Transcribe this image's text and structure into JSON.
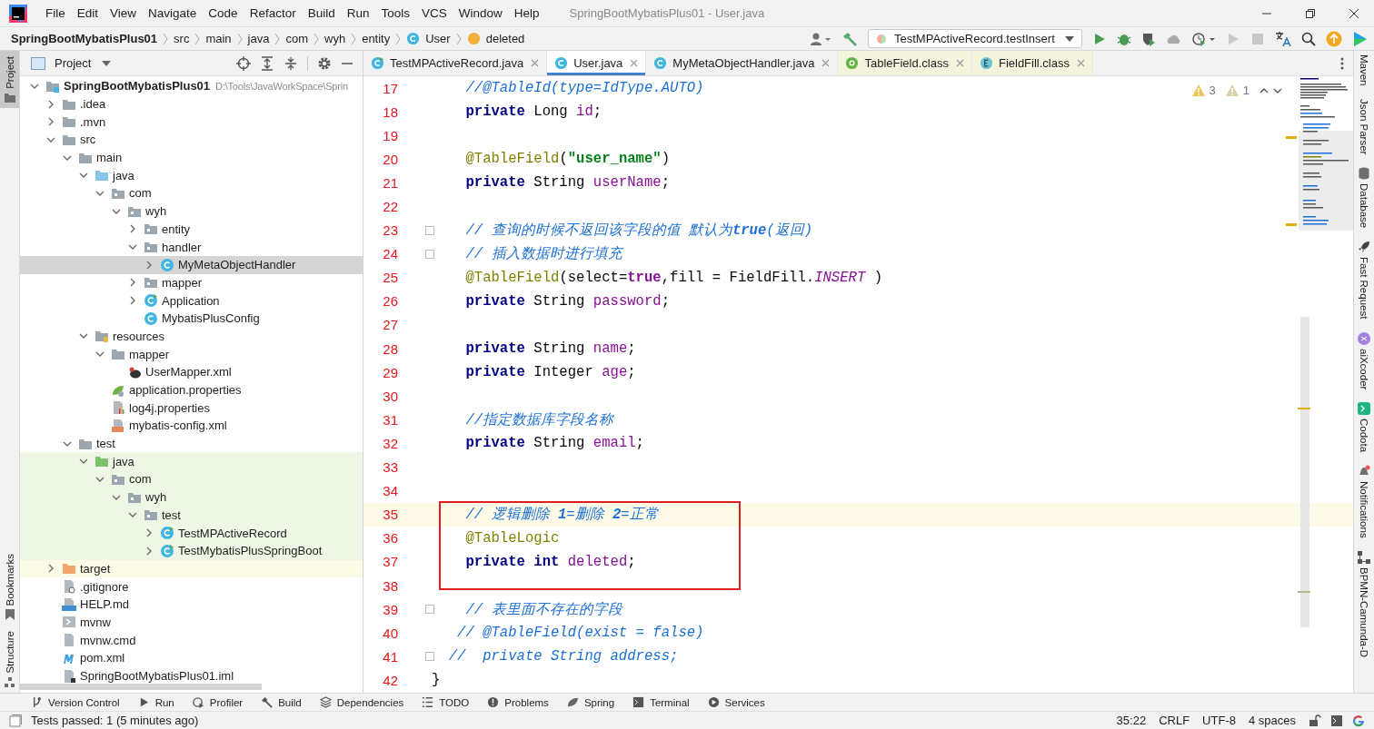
{
  "window": {
    "title": "SpringBootMybatisPlus01 - User.java"
  },
  "menu": [
    "File",
    "Edit",
    "View",
    "Navigate",
    "Code",
    "Refactor",
    "Build",
    "Run",
    "Tools",
    "VCS",
    "Window",
    "Help"
  ],
  "breadcrumbs": [
    {
      "label": "SpringBootMybatisPlus01",
      "kind": "project"
    },
    {
      "label": "src",
      "kind": "folder"
    },
    {
      "label": "main",
      "kind": "folder"
    },
    {
      "label": "java",
      "kind": "folder"
    },
    {
      "label": "com",
      "kind": "folder"
    },
    {
      "label": "wyh",
      "kind": "folder"
    },
    {
      "label": "entity",
      "kind": "folder"
    },
    {
      "label": "User",
      "kind": "class"
    },
    {
      "label": "deleted",
      "kind": "field"
    }
  ],
  "run_config": {
    "label": "TestMPActiveRecord.testInsert"
  },
  "project_panel": {
    "title": "Project"
  },
  "tree": [
    {
      "label": "SpringBootMybatisPlus01",
      "path": "D:\\Tools\\JavaWorkSpace\\Sprin",
      "kind": "module",
      "expanded": true,
      "selected": false,
      "children": [
        {
          "label": ".idea",
          "kind": "folder",
          "expanded": false,
          "selected": false
        },
        {
          "label": ".mvn",
          "kind": "folder",
          "expanded": false,
          "selected": false
        },
        {
          "label": "src",
          "kind": "folder",
          "expanded": true,
          "selected": false,
          "children": [
            {
              "label": "main",
              "kind": "folder",
              "expanded": true,
              "selected": false,
              "children": [
                {
                  "label": "java",
                  "kind": "folder-source",
                  "expanded": true,
                  "selected": false,
                  "children": [
                    {
                      "label": "com",
                      "kind": "package",
                      "expanded": true,
                      "selected": false,
                      "children": [
                        {
                          "label": "wyh",
                          "kind": "package",
                          "expanded": true,
                          "selected": false,
                          "children": [
                            {
                              "label": "entity",
                              "kind": "package",
                              "expanded": false,
                              "selected": false
                            },
                            {
                              "label": "handler",
                              "kind": "package",
                              "expanded": true,
                              "selected": false,
                              "children": [
                                {
                                  "label": "MyMetaObjectHandler",
                                  "kind": "class",
                                  "expanded": false,
                                  "selected": true
                                }
                              ]
                            },
                            {
                              "label": "mapper",
                              "kind": "package",
                              "expanded": false,
                              "selected": false
                            },
                            {
                              "label": "Application",
                              "kind": "class-run",
                              "expanded": false,
                              "selected": false
                            },
                            {
                              "label": "MybatisPlusConfig",
                              "kind": "class",
                              "selected": false
                            }
                          ]
                        }
                      ]
                    }
                  ]
                },
                {
                  "label": "resources",
                  "kind": "folder-resources",
                  "expanded": true,
                  "selected": false,
                  "children": [
                    {
                      "label": "mapper",
                      "kind": "folder",
                      "expanded": true,
                      "selected": false,
                      "children": [
                        {
                          "label": "UserMapper.xml",
                          "kind": "mybatis-xml",
                          "selected": false
                        }
                      ]
                    },
                    {
                      "label": "application.properties",
                      "kind": "spring-properties",
                      "selected": false
                    },
                    {
                      "label": "log4j.properties",
                      "kind": "properties",
                      "selected": false
                    },
                    {
                      "label": "mybatis-config.xml",
                      "kind": "xml",
                      "selected": false
                    }
                  ]
                }
              ]
            },
            {
              "label": "test",
              "kind": "folder",
              "expanded": true,
              "selected": false,
              "children": [
                {
                  "label": "java",
                  "kind": "folder-test",
                  "expanded": true,
                  "selected": false,
                  "test_scope": true,
                  "children": [
                    {
                      "label": "com",
                      "kind": "package",
                      "expanded": true,
                      "selected": false,
                      "test_scope": true,
                      "children": [
                        {
                          "label": "wyh",
                          "kind": "package",
                          "expanded": true,
                          "selected": false,
                          "test_scope": true,
                          "children": [
                            {
                              "label": "test",
                              "kind": "package",
                              "expanded": true,
                              "selected": false,
                              "test_scope": true,
                              "children": [
                                {
                                  "label": "TestMPActiveRecord",
                                  "kind": "class-test",
                                  "expanded": false,
                                  "selected": false,
                                  "test_scope": true
                                },
                                {
                                  "label": "TestMybatisPlusSpringBoot",
                                  "kind": "class-test",
                                  "expanded": false,
                                  "selected": false,
                                  "test_scope": true
                                }
                              ]
                            }
                          ]
                        }
                      ]
                    }
                  ]
                }
              ]
            }
          ]
        },
        {
          "label": "target",
          "kind": "folder-excluded",
          "expanded": false,
          "selected": false,
          "excluded": true
        },
        {
          "label": ".gitignore",
          "kind": "gitignore",
          "selected": false
        },
        {
          "label": "HELP.md",
          "kind": "markdown",
          "selected": false
        },
        {
          "label": "mvnw",
          "kind": "script",
          "selected": false
        },
        {
          "label": "mvnw.cmd",
          "kind": "text",
          "selected": false
        },
        {
          "label": "pom.xml",
          "kind": "maven",
          "selected": false
        },
        {
          "label": "SpringBootMybatisPlus01.iml",
          "kind": "iml",
          "selected": false
        }
      ]
    }
  ],
  "tabs": [
    {
      "label": "TestMPActiveRecord.java",
      "kind": "class-test",
      "selected": false,
      "library": false
    },
    {
      "label": "User.java",
      "kind": "class",
      "selected": true,
      "library": false
    },
    {
      "label": "MyMetaObjectHandler.java",
      "kind": "class",
      "selected": false,
      "library": false
    },
    {
      "label": "TableField.class",
      "kind": "annotation",
      "selected": false,
      "library": true
    },
    {
      "label": "FieldFill.class",
      "kind": "enum",
      "selected": false,
      "library": true
    }
  ],
  "inspections": {
    "warnings": "3",
    "weak_warnings": "1"
  },
  "code": [
    {
      "number": "17",
      "segments": [
        {
          "text": "    //@TableId(type=IdType.AUTO)",
          "kind": "comment"
        }
      ]
    },
    {
      "number": "18",
      "segments": [
        {
          "text": "    private",
          "kind": "keyword"
        },
        {
          "text": " Long ",
          "kind": "plain"
        },
        {
          "text": "id",
          "kind": "field"
        },
        {
          "text": ";",
          "kind": "plain"
        }
      ]
    },
    {
      "number": "19"
    },
    {
      "number": "20",
      "segments": [
        {
          "text": "    @TableField",
          "kind": "annotation"
        },
        {
          "text": "(",
          "kind": "plain"
        },
        {
          "text": "\"user_name\"",
          "kind": "string"
        },
        {
          "text": ")",
          "kind": "plain"
        }
      ]
    },
    {
      "number": "21",
      "segments": [
        {
          "text": "    private",
          "kind": "keyword"
        },
        {
          "text": " String ",
          "kind": "plain"
        },
        {
          "text": "userName",
          "kind": "field"
        },
        {
          "text": ";",
          "kind": "plain"
        }
      ]
    },
    {
      "number": "22"
    },
    {
      "number": "23",
      "fold_marker": true,
      "segments": [
        {
          "text": "    // 查询的时候不返回该字段的值 默认为",
          "kind": "comment"
        },
        {
          "text": "true",
          "kind": "comment-bold"
        },
        {
          "text": "(返回)",
          "kind": "comment"
        }
      ]
    },
    {
      "number": "24",
      "fold_marker": true,
      "segments": [
        {
          "text": "    // 插入数据时进行填充",
          "kind": "comment"
        }
      ]
    },
    {
      "number": "25",
      "segments": [
        {
          "text": "    @TableField",
          "kind": "annotation"
        },
        {
          "text": "(select=",
          "kind": "plain"
        },
        {
          "text": "true",
          "kind": "literal"
        },
        {
          "text": ",fill = FieldFill.",
          "kind": "plain"
        },
        {
          "text": "INSERT",
          "kind": "constant"
        },
        {
          "text": " )",
          "kind": "plain"
        }
      ]
    },
    {
      "number": "26",
      "segments": [
        {
          "text": "    private",
          "kind": "keyword"
        },
        {
          "text": " String ",
          "kind": "plain"
        },
        {
          "text": "password",
          "kind": "field"
        },
        {
          "text": ";",
          "kind": "plain"
        }
      ]
    },
    {
      "number": "27"
    },
    {
      "number": "28",
      "segments": [
        {
          "text": "    private",
          "kind": "keyword"
        },
        {
          "text": " String ",
          "kind": "plain"
        },
        {
          "text": "name",
          "kind": "field"
        },
        {
          "text": ";",
          "kind": "plain"
        }
      ]
    },
    {
      "number": "29",
      "segments": [
        {
          "text": "    private",
          "kind": "keyword"
        },
        {
          "text": " Integer ",
          "kind": "plain"
        },
        {
          "text": "age",
          "kind": "field"
        },
        {
          "text": ";",
          "kind": "plain"
        }
      ]
    },
    {
      "number": "30"
    },
    {
      "number": "31",
      "segments": [
        {
          "text": "    //指定数据库字段名称",
          "kind": "comment"
        }
      ]
    },
    {
      "number": "32",
      "segments": [
        {
          "text": "    private",
          "kind": "keyword"
        },
        {
          "text": " String ",
          "kind": "plain"
        },
        {
          "text": "email",
          "kind": "field"
        },
        {
          "text": ";",
          "kind": "plain"
        }
      ]
    },
    {
      "number": "33"
    },
    {
      "number": "34"
    },
    {
      "number": "35",
      "current": true,
      "boxed": true,
      "segments": [
        {
          "text": "    // 逻辑删除 ",
          "kind": "comment"
        },
        {
          "text": "1",
          "kind": "comment-bold"
        },
        {
          "text": "=删除 ",
          "kind": "comment"
        },
        {
          "text": "2",
          "kind": "comment-bold"
        },
        {
          "text": "=正常",
          "kind": "comment"
        }
      ]
    },
    {
      "number": "36",
      "boxed": true,
      "segments": [
        {
          "text": "    @TableLogic",
          "kind": "annotation"
        }
      ]
    },
    {
      "number": "37",
      "boxed": true,
      "segments": [
        {
          "text": "    private int",
          "kind": "keyword"
        },
        {
          "text": " deleted",
          "kind": "field"
        },
        {
          "text": ";",
          "kind": "plain"
        }
      ]
    },
    {
      "number": "38"
    },
    {
      "number": "39",
      "fold_marker": true,
      "segments": [
        {
          "text": "    // 表里面不存在的字段",
          "kind": "comment"
        }
      ]
    },
    {
      "number": "40",
      "segments": [
        {
          "text": "   // @TableField(exist = false)",
          "kind": "comment"
        }
      ]
    },
    {
      "number": "41",
      "fold_marker": true,
      "segments": [
        {
          "text": "  //  private String address;",
          "kind": "comment"
        }
      ]
    },
    {
      "number": "42",
      "segments": [
        {
          "text": "}",
          "kind": "plain"
        }
      ]
    }
  ],
  "left_strip_top": [
    {
      "label": "Project",
      "kind": "folder",
      "selected": true
    }
  ],
  "left_strip_bottom": [
    {
      "label": "Bookmarks",
      "kind": "bookmark",
      "selected": false
    },
    {
      "label": "Structure",
      "kind": "structure",
      "selected": false
    }
  ],
  "right_strip": [
    {
      "label": "Maven",
      "kind": "none"
    },
    {
      "label": "Json Parser",
      "kind": "none"
    },
    {
      "label": "Database",
      "kind": "database"
    },
    {
      "label": "Fast Request",
      "kind": "rocket"
    },
    {
      "label": "aiXcoder",
      "kind": "aix"
    },
    {
      "label": "Codota",
      "kind": "codota"
    },
    {
      "label": "Notifications",
      "kind": "bell"
    },
    {
      "label": "BPMN-Camunda-D",
      "kind": "bpmn"
    }
  ],
  "tool_buttons": [
    {
      "label": "Version Control",
      "kind": "vcs"
    },
    {
      "label": "Run",
      "kind": "run"
    },
    {
      "label": "Profiler",
      "kind": "profiler"
    },
    {
      "label": "Build",
      "kind": "build"
    },
    {
      "label": "Dependencies",
      "kind": "deps"
    },
    {
      "label": "TODO",
      "kind": "todo"
    },
    {
      "label": "Problems",
      "kind": "problems"
    },
    {
      "label": "Spring",
      "kind": "spring"
    },
    {
      "label": "Terminal",
      "kind": "terminal"
    },
    {
      "label": "Services",
      "kind": "services"
    }
  ],
  "status_bar": {
    "message": "Tests passed: 1 (5 minutes ago)",
    "items": [
      "35:22",
      "CRLF",
      "UTF-8",
      "4 spaces"
    ]
  }
}
